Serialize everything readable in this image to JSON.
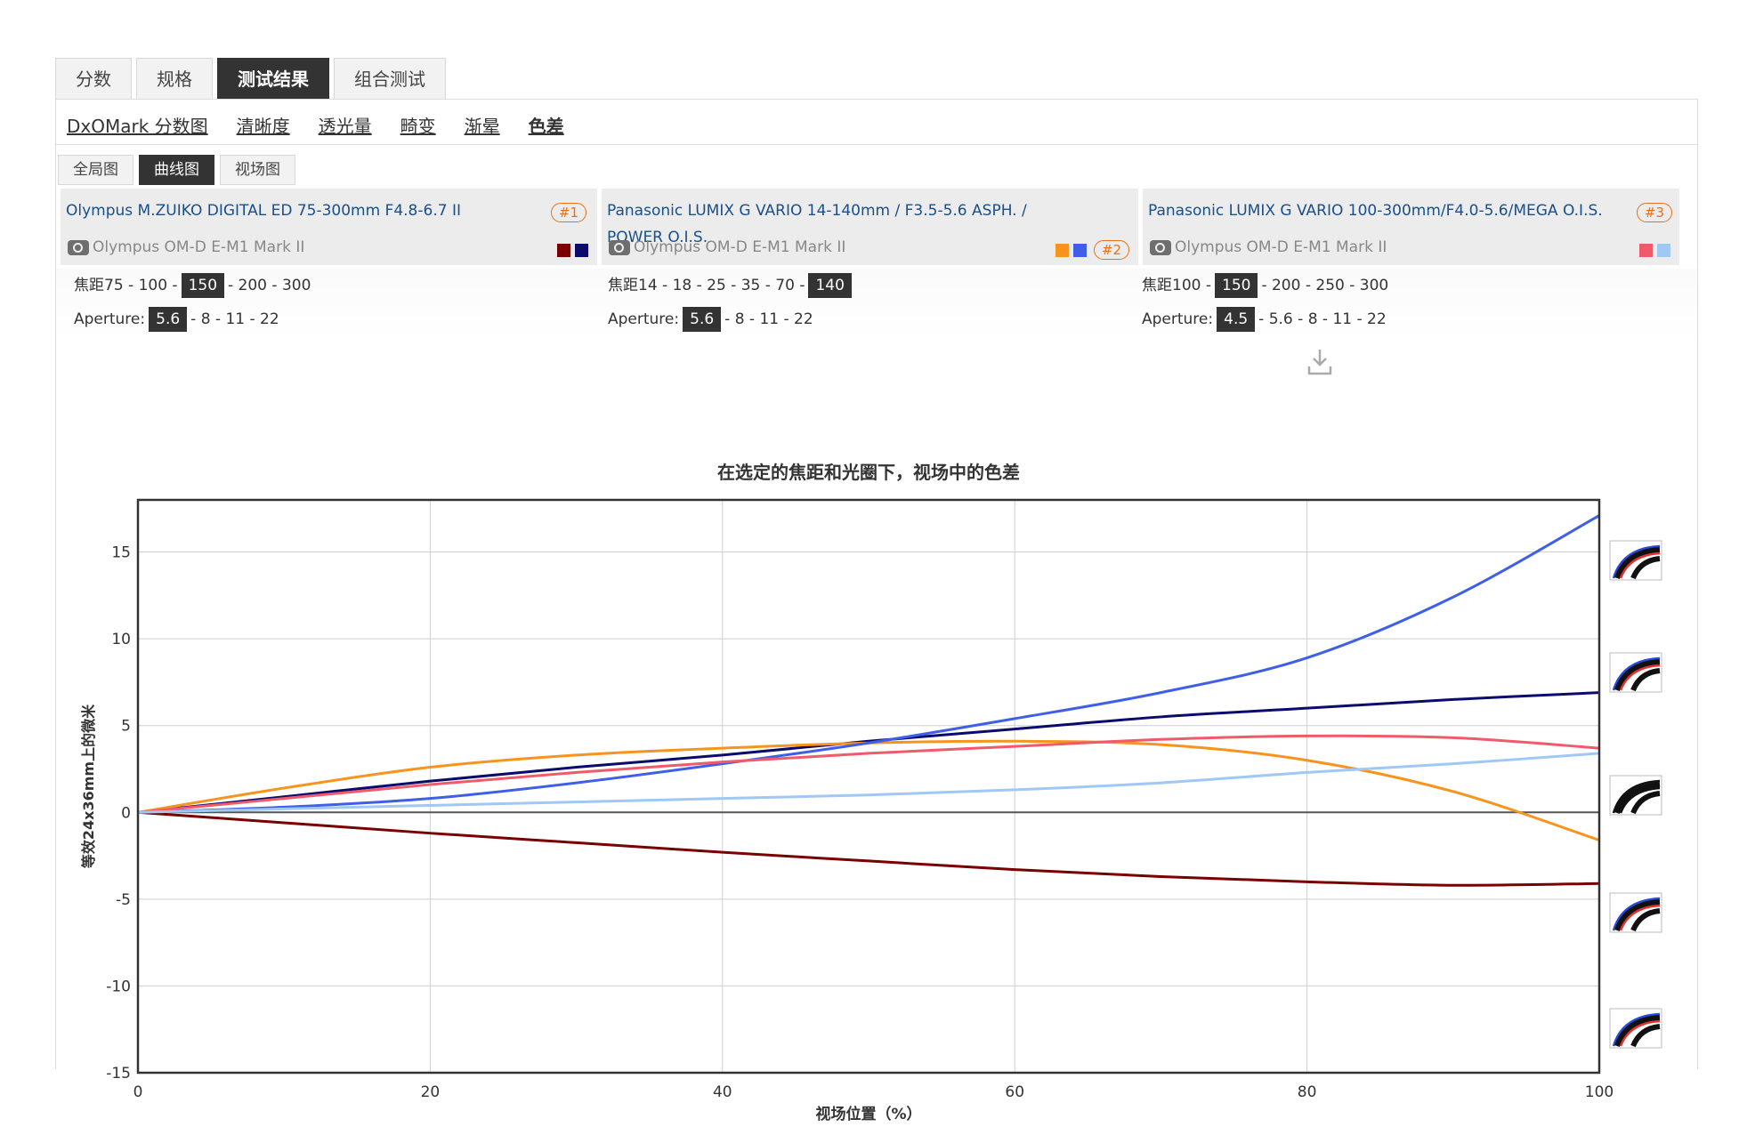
{
  "tabs": [
    {
      "label": "分数"
    },
    {
      "label": "规格"
    },
    {
      "label": "测试结果"
    },
    {
      "label": "组合测试"
    }
  ],
  "subnav": [
    {
      "label": "DxOMark 分数图"
    },
    {
      "label": "清晰度"
    },
    {
      "label": "透光量"
    },
    {
      "label": "畸变"
    },
    {
      "label": "渐晕"
    },
    {
      "label": "色差"
    }
  ],
  "view_tabs": [
    {
      "label": "全局图"
    },
    {
      "label": "曲线图"
    },
    {
      "label": "视场图"
    }
  ],
  "lenses": [
    {
      "name": "Olympus M.ZUIKO DIGITAL ED 75-300mm F4.8-6.7 II",
      "rank": "#1",
      "camera": "Olympus OM-D E-M1 Mark II",
      "colors": [
        "#7a0000",
        "#0b0b6e"
      ],
      "focal_label": "焦距",
      "focal_pre": "75 - 100 -",
      "focal_sel": "150",
      "focal_post": "- 200 - 300",
      "aperture_label": "Aperture:",
      "aperture_pre": "",
      "aperture_sel": "5.6",
      "aperture_post": "- 8 - 11 - 22"
    },
    {
      "name": "Panasonic LUMIX G VARIO 14-140mm / F3.5-5.6 ASPH. / POWER O.I.S.",
      "rank": "#2",
      "camera": "Olympus OM-D E-M1 Mark II",
      "colors": [
        "#f7941d",
        "#3f5fe8"
      ],
      "focal_label": "焦距",
      "focal_pre": "14 - 18 - 25 - 35 - 70 -",
      "focal_sel": "140",
      "focal_post": "",
      "aperture_label": "Aperture:",
      "aperture_pre": "",
      "aperture_sel": "5.6",
      "aperture_post": "- 8 - 11 - 22"
    },
    {
      "name": "Panasonic LUMIX G VARIO 100-300mm/F4.0-5.6/MEGA O.I.S.",
      "rank": "#3",
      "camera": "Olympus OM-D E-M1 Mark II",
      "colors": [
        "#f05a6a",
        "#9fc8f5"
      ],
      "focal_label": "焦距",
      "focal_pre": "100 -",
      "focal_sel": "150",
      "focal_post": "- 200 - 250 - 300",
      "aperture_label": "Aperture:",
      "aperture_pre": "",
      "aperture_sel": "4.5",
      "aperture_post": "- 5.6 - 8 - 11 - 22"
    }
  ],
  "chart_data": {
    "type": "line",
    "title": "在选定的焦距和光圈下，视场中的色差",
    "xlabel": "视场位置（%）",
    "ylabel": "等效24x36mm上的微米",
    "xlim": [
      0,
      100
    ],
    "ylim": [
      -15,
      18
    ],
    "xticks": [
      0,
      20,
      40,
      60,
      80,
      100
    ],
    "yticks": [
      -15,
      -10,
      -5,
      0,
      5,
      10,
      15
    ],
    "grid": true,
    "x": [
      0,
      10,
      20,
      30,
      40,
      50,
      60,
      70,
      80,
      90,
      100
    ],
    "series": [
      {
        "color": "#7a0000",
        "values": [
          0,
          -0.6,
          -1.2,
          -1.75,
          -2.3,
          -2.8,
          -3.3,
          -3.7,
          -4.0,
          -4.2,
          -4.1
        ]
      },
      {
        "color": "#0b0b6e",
        "values": [
          0,
          0.9,
          1.8,
          2.6,
          3.3,
          4.1,
          4.8,
          5.5,
          6.0,
          6.5,
          6.9
        ]
      },
      {
        "color": "#f7941d",
        "values": [
          0,
          1.4,
          2.6,
          3.3,
          3.7,
          4.0,
          4.1,
          3.9,
          3.0,
          1.2,
          -1.6
        ]
      },
      {
        "color": "#3f5fe8",
        "values": [
          0,
          0.3,
          0.8,
          1.7,
          2.8,
          4.0,
          5.4,
          6.9,
          8.9,
          12.4,
          17.1
        ]
      },
      {
        "color": "#f05a6a",
        "values": [
          0,
          0.8,
          1.6,
          2.3,
          2.9,
          3.4,
          3.8,
          4.2,
          4.4,
          4.3,
          3.7
        ]
      },
      {
        "color": "#9fc8f5",
        "values": [
          0,
          0.2,
          0.4,
          0.6,
          0.8,
          1.0,
          1.3,
          1.7,
          2.3,
          2.8,
          3.4
        ]
      }
    ]
  },
  "sample_icons": [
    "ca-sample-icon-1",
    "ca-sample-icon-2",
    "ca-sample-icon-3",
    "ca-sample-icon-4",
    "ca-sample-icon-5"
  ]
}
